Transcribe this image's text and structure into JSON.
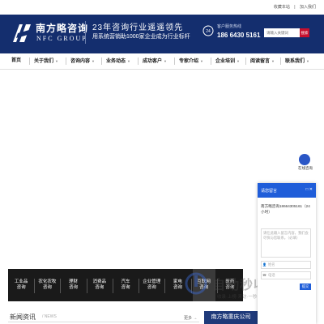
{
  "topbar": {
    "favorite": "收藏本站",
    "join": "加入我们"
  },
  "header": {
    "brand_cn": "南方略咨询",
    "brand_en": "NFC GROUP",
    "slogan": "23年咨询行业遥遥领先",
    "subslogan": "用系统营销助1000家企业成为行业标杆",
    "hotline_label": "客户服务热线",
    "hotline": "186 6430 5161",
    "search_placeholder": "请输入关键词",
    "search_button": "搜索"
  },
  "nav": [
    {
      "label": "首页",
      "has_caret": false
    },
    {
      "label": "关于我们",
      "has_caret": true
    },
    {
      "label": "咨询内容",
      "has_caret": true
    },
    {
      "label": "业务动态",
      "has_caret": true
    },
    {
      "label": "成功客户",
      "has_caret": true
    },
    {
      "label": "专家介绍",
      "has_caret": true
    },
    {
      "label": "企业培训",
      "has_caret": true
    },
    {
      "label": "阅读留言",
      "has_caret": true
    },
    {
      "label": "联系我们",
      "has_caret": true
    }
  ],
  "categories": [
    {
      "line1": "工业品",
      "line2": "咨询",
      "active": false
    },
    {
      "line1": "农化农牧",
      "line2": "咨询",
      "active": false
    },
    {
      "line1": "理财",
      "line2": "咨询",
      "active": false
    },
    {
      "line1": "消费品",
      "line2": "咨询",
      "active": false
    },
    {
      "line1": "汽车",
      "line2": "咨询",
      "active": false
    },
    {
      "line1": "企业管理",
      "line2": "咨询",
      "active": false
    },
    {
      "line1": "家电",
      "line2": "咨询",
      "active": false
    },
    {
      "line1": "互联网",
      "line2": "咨询",
      "active": true
    },
    {
      "line1": "医药",
      "line2": "咨询",
      "active": false
    }
  ],
  "news": {
    "title": "新闻资讯",
    "subtitle": "/ NEWS",
    "more": "更多 →"
  },
  "branch_link": "南方略重庆公司",
  "branch_note": "",
  "floating": {
    "label": "在线咨询"
  },
  "widget": {
    "title": "请您留言",
    "icons": "□ ✕",
    "message": "南方略咨询18664305161（24小时）",
    "textarea_placeholder": "请在此输入留言内容，我们会尽快与您联系。（必填）",
    "name_placeholder": "姓名",
    "phone_placeholder": "电话",
    "submit": "提交"
  },
  "watermark": {
    "text": "自动秒收录",
    "sub": "收录·上榜·来访·一秒·自动收录"
  },
  "colors": {
    "header_blue": "#142e6e",
    "accent_red": "#c8102e",
    "widget_blue": "#1f5dd9",
    "category_dark": "#1a1a1a"
  }
}
